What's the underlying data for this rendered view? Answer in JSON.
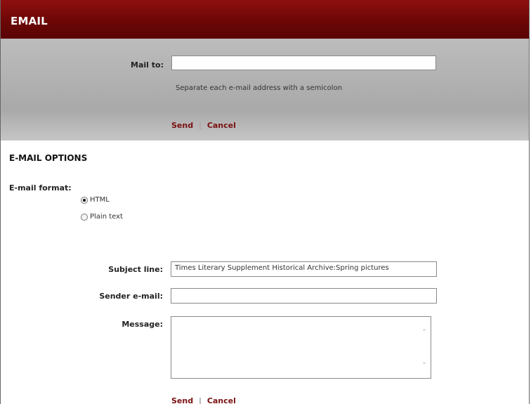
{
  "window": {
    "title": "EMAIL"
  },
  "mail_to": {
    "label": "Mail to:",
    "value": "",
    "hint": "Separate each e-mail address with a semicolon"
  },
  "top_actions": {
    "send": "Send",
    "cancel": "Cancel",
    "separator": "|"
  },
  "options": {
    "heading": "E-MAIL OPTIONS",
    "format_label": "E-mail format:",
    "formats": [
      {
        "label": "HTML",
        "selected": true
      },
      {
        "label": "Plain text",
        "selected": false
      }
    ]
  },
  "subject": {
    "label": "Subject line:",
    "value": "Times Literary Supplement Historical Archive:Spring pictures"
  },
  "sender": {
    "label": "Sender e-mail:",
    "value": ""
  },
  "message": {
    "label": "Message:",
    "value": ""
  },
  "bottom_actions": {
    "send": "Send",
    "cancel": "Cancel",
    "separator": "|"
  },
  "colors": {
    "title_bar": "#6a0606",
    "link": "#7a1010",
    "panel_gray": "#b3b3b3"
  }
}
